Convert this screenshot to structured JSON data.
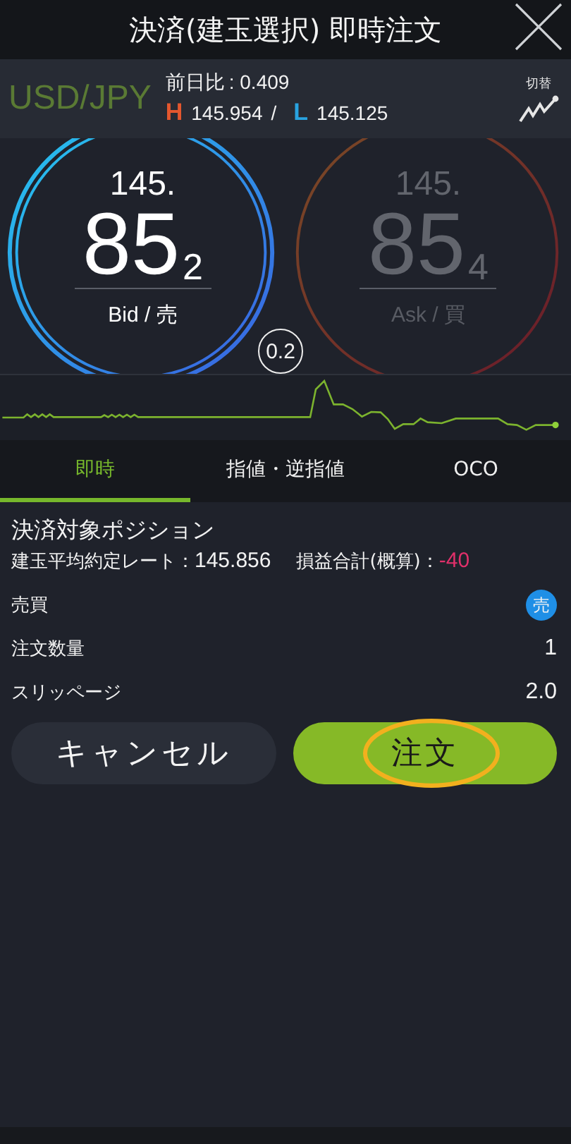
{
  "title": "決済(建玉選択) 即時注文",
  "quote": {
    "pair": "USD/JPY",
    "change_label": "前日比",
    "change": ": 0.409",
    "high_label": "H",
    "high": "145.954",
    "separator": "/",
    "low_label": "L",
    "low": "145.125",
    "switch_label": "切替"
  },
  "prices": [
    {
      "kind": "bid",
      "big_figure": "145.",
      "pips": "85",
      "fraction": "2",
      "label": "Bid / 売",
      "active": true
    },
    {
      "kind": "ask",
      "big_figure": "145.",
      "pips": "85",
      "fraction": "4",
      "label": "Ask / 買",
      "active": false
    }
  ],
  "spread": "0.2",
  "tabs": [
    {
      "label": "即時",
      "selected": true
    },
    {
      "label": "指値・逆指値",
      "selected": false
    },
    {
      "label": "OCO",
      "selected": false
    }
  ],
  "position": {
    "title": "決済対象ポジション",
    "rate_label": "建玉平均約定レート：",
    "rate": "145.856",
    "pl_label": "損益合計(概算)：",
    "pl": "-40"
  },
  "rows": [
    {
      "kind": "side",
      "label": "売買",
      "value": "売"
    },
    {
      "kind": "text",
      "label": "注文数量",
      "value": "1"
    },
    {
      "kind": "text",
      "label": "スリッページ",
      "value": "2.0"
    }
  ],
  "buttons": [
    {
      "kind": "cancel",
      "label": "キャンセル",
      "circled": false
    },
    {
      "kind": "order",
      "label": "注文",
      "circled": true
    }
  ]
}
